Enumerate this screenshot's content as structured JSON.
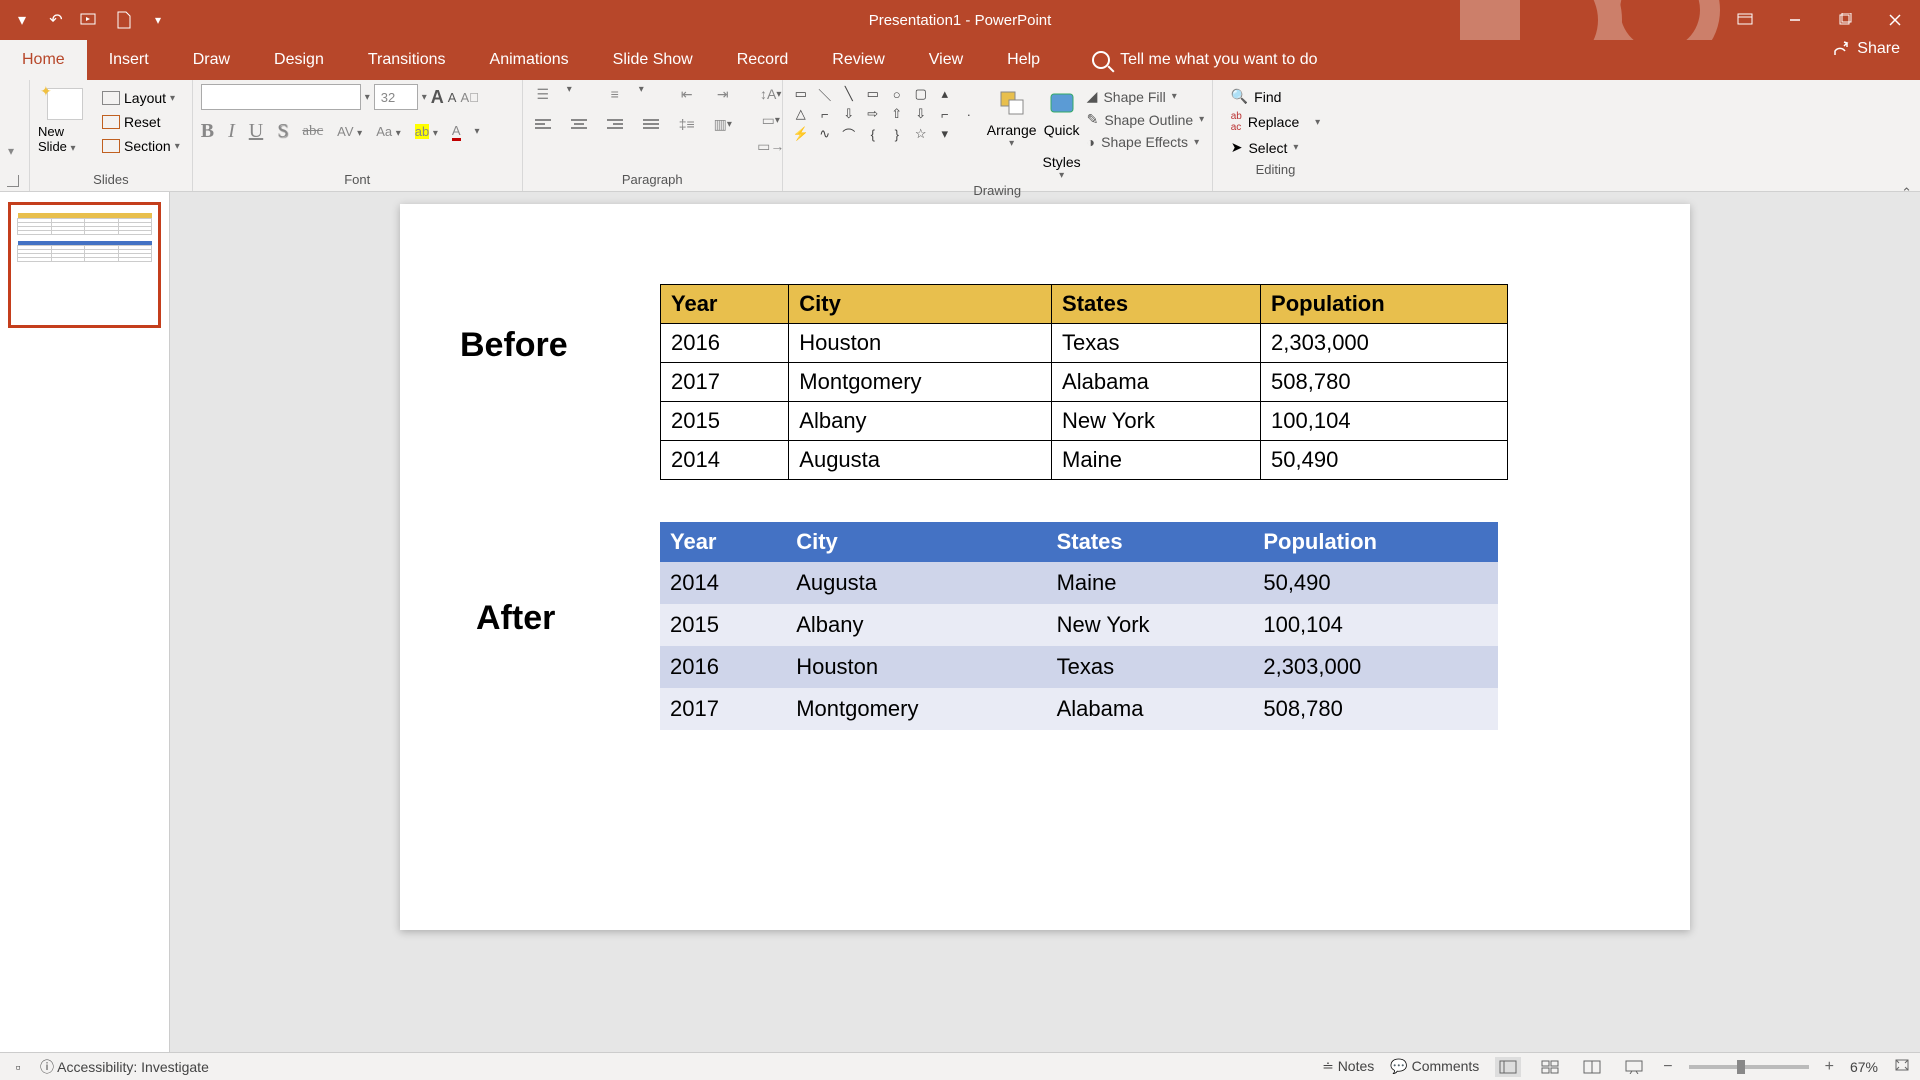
{
  "titlebar": {
    "title": "Presentation1  -  PowerPoint"
  },
  "tabs": {
    "home": "Home",
    "insert": "Insert",
    "draw": "Draw",
    "design": "Design",
    "transitions": "Transitions",
    "animations": "Animations",
    "slideshow": "Slide Show",
    "record": "Record",
    "review": "Review",
    "view": "View",
    "help": "Help",
    "tellme": "Tell me what you want to do",
    "share": "Share"
  },
  "ribbon": {
    "slides": {
      "new_slide": "New Slide",
      "layout": "Layout",
      "reset": "Reset",
      "section": "Section",
      "group": "Slides"
    },
    "font": {
      "size": "32",
      "group": "Font"
    },
    "paragraph": {
      "group": "Paragraph"
    },
    "drawing": {
      "arrange": "Arrange",
      "quick_styles_1": "Quick",
      "quick_styles_2": "Styles",
      "shape_fill": "Shape Fill",
      "shape_outline": "Shape Outline",
      "shape_effects": "Shape Effects",
      "group": "Drawing"
    },
    "editing": {
      "find": "Find",
      "replace": "Replace",
      "select": "Select",
      "group": "Editing"
    }
  },
  "slide": {
    "before_label": "Before",
    "after_label": "After",
    "before_table": {
      "headers": [
        "Year",
        "City",
        "States",
        "Population"
      ],
      "rows": [
        [
          "2016",
          "Houston",
          "Texas",
          "2,303,000"
        ],
        [
          "2017",
          "Montgomery",
          "Alabama",
          "508,780"
        ],
        [
          "2015",
          "Albany",
          "New York",
          "100,104"
        ],
        [
          "2014",
          "Augusta",
          "Maine",
          "50,490"
        ]
      ]
    },
    "after_table": {
      "headers": [
        "Year",
        "City",
        "States",
        "Population"
      ],
      "rows": [
        [
          "2014",
          "Augusta",
          "Maine",
          "50,490"
        ],
        [
          "2015",
          "Albany",
          "New York",
          "100,104"
        ],
        [
          "2016",
          "Houston",
          "Texas",
          "2,303,000"
        ],
        [
          "2017",
          "Montgomery",
          "Alabama",
          "508,780"
        ]
      ]
    }
  },
  "statusbar": {
    "accessibility": "Accessibility: Investigate",
    "notes": "Notes",
    "comments": "Comments",
    "zoom": "67%"
  },
  "chart_data": [
    {
      "type": "table",
      "title": "Before",
      "columns": [
        "Year",
        "City",
        "States",
        "Population"
      ],
      "rows": [
        {
          "Year": 2016,
          "City": "Houston",
          "States": "Texas",
          "Population": 2303000
        },
        {
          "Year": 2017,
          "City": "Montgomery",
          "States": "Alabama",
          "Population": 508780
        },
        {
          "Year": 2015,
          "City": "Albany",
          "States": "New York",
          "Population": 100104
        },
        {
          "Year": 2014,
          "City": "Augusta",
          "States": "Maine",
          "Population": 50490
        }
      ]
    },
    {
      "type": "table",
      "title": "After",
      "columns": [
        "Year",
        "City",
        "States",
        "Population"
      ],
      "rows": [
        {
          "Year": 2014,
          "City": "Augusta",
          "States": "Maine",
          "Population": 50490
        },
        {
          "Year": 2015,
          "City": "Albany",
          "States": "New York",
          "Population": 100104
        },
        {
          "Year": 2016,
          "City": "Houston",
          "States": "Texas",
          "Population": 2303000
        },
        {
          "Year": 2017,
          "City": "Montgomery",
          "States": "Alabama",
          "Population": 508780
        }
      ]
    }
  ]
}
